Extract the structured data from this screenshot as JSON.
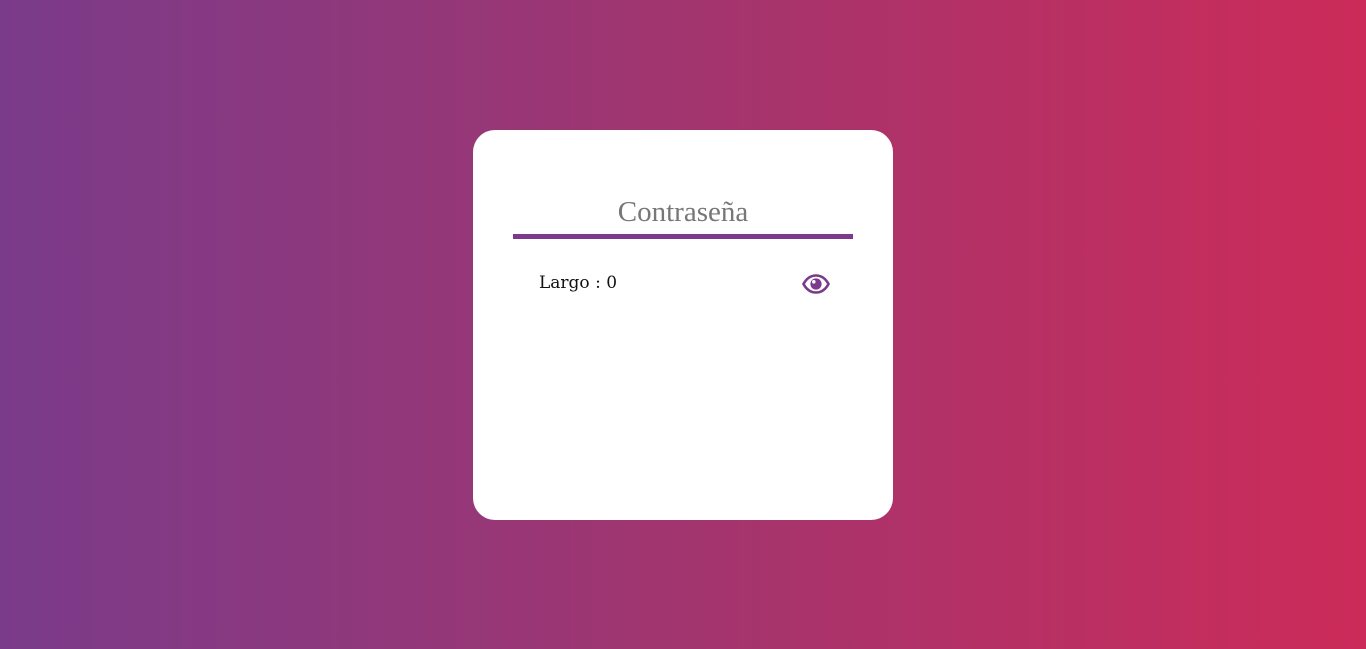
{
  "password": {
    "placeholder": "Contraseña",
    "value": ""
  },
  "length": {
    "label": "Largo",
    "separator": " : ",
    "count": "0"
  },
  "toggle": {
    "icon": "eye-icon"
  },
  "colors": {
    "accent": "#7b3a8c",
    "gradient_start": "#7a3b8a",
    "gradient_end": "#cc2b59",
    "card": "#ffffff"
  }
}
